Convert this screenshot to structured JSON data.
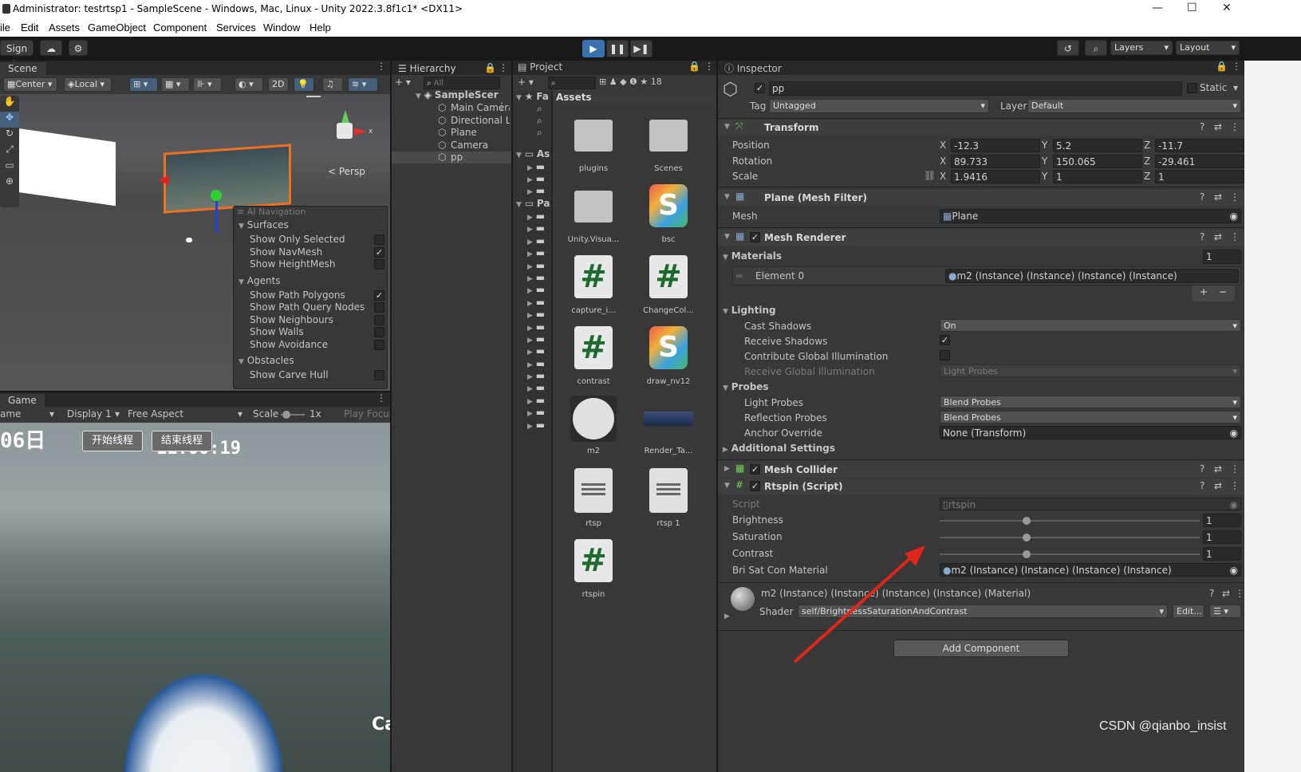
{
  "window": {
    "title": "Administrator: testrtsp1 - SampleScene - Windows, Mac, Linux - Unity 2022.3.8f1c1* <DX11>",
    "min": "—",
    "max": "☐",
    "close": "✕"
  },
  "menu": [
    "ile",
    "Edit",
    "Assets",
    "GameObject",
    "Component",
    "Services",
    "Window",
    "Help"
  ],
  "toolbar": {
    "signin": "Sign in",
    "layers": "Layers",
    "layout": "Layout"
  },
  "scene": {
    "tab": "Scene",
    "pivot": "Center",
    "space": "Local",
    "mode2d": "2D",
    "persp": "< Persp",
    "overlay": {
      "title": "AI Navigation",
      "sections": [
        {
          "name": "Surfaces",
          "items": [
            {
              "label": "Show Only Selected",
              "checked": false
            },
            {
              "label": "Show NavMesh",
              "checked": true
            },
            {
              "label": "Show HeightMesh",
              "checked": false
            }
          ]
        },
        {
          "name": "Agents",
          "items": [
            {
              "label": "Show Path Polygons",
              "checked": true
            },
            {
              "label": "Show Path Query Nodes",
              "checked": false
            },
            {
              "label": "Show Neighbours",
              "checked": false
            },
            {
              "label": "Show Walls",
              "checked": false
            },
            {
              "label": "Show Avoidance",
              "checked": false
            }
          ]
        },
        {
          "name": "Obstacles",
          "items": [
            {
              "label": "Show Carve Hull",
              "checked": false
            }
          ]
        }
      ]
    }
  },
  "game": {
    "tab": "Game",
    "view": "ame",
    "display": "Display 1",
    "aspect": "Free Aspect",
    "scale_label": "Scale",
    "scale_value": "1x",
    "play": "Play Focus",
    "date": "06日",
    "time": "11:00:19",
    "btn_start": "开始线程",
    "btn_end": "结束线程",
    "corner": "Ca"
  },
  "hierarchy": {
    "tab": "Hierarchy",
    "search": "All",
    "scene": "SampleScer",
    "items": [
      "Main Camera",
      "Directional Lig",
      "Plane",
      "Camera",
      "pp"
    ]
  },
  "project": {
    "tab": "Project",
    "fav": "Fa",
    "assets_tree": "As",
    "packages_tree": "Pa",
    "breadcrumb": "Assets",
    "count": "18",
    "assets": [
      {
        "name": "plugins",
        "kind": "folder"
      },
      {
        "name": "Scenes",
        "kind": "folder"
      },
      {
        "name": "Unity.Visua...",
        "kind": "folder"
      },
      {
        "name": "bsc",
        "kind": "shader"
      },
      {
        "name": "capture_i...",
        "kind": "script"
      },
      {
        "name": "ChangeCol...",
        "kind": "script"
      },
      {
        "name": "contrast",
        "kind": "script"
      },
      {
        "name": "draw_nv12",
        "kind": "shader"
      },
      {
        "name": "m2",
        "kind": "material"
      },
      {
        "name": "Render_Ta...",
        "kind": "texture"
      },
      {
        "name": "rtsp",
        "kind": "text"
      },
      {
        "name": "rtsp 1",
        "kind": "text"
      },
      {
        "name": "rtspin",
        "kind": "script"
      }
    ]
  },
  "inspector": {
    "tab": "Inspector",
    "name": "pp",
    "static": "Static",
    "tag_label": "Tag",
    "tag": "Untagged",
    "layer_label": "Layer",
    "layer": "Default",
    "transform": {
      "title": "Transform",
      "position_label": "Position",
      "rotation_label": "Rotation",
      "scale_label": "Scale",
      "position": {
        "x": "-12.3",
        "y": "5.2",
        "z": "-11.7"
      },
      "rotation": {
        "x": "89.733",
        "y": "150.065",
        "z": "-29.461"
      },
      "scale": {
        "x": "1.9416",
        "y": "1",
        "z": "1"
      }
    },
    "meshfilter": {
      "title": "Plane (Mesh Filter)",
      "mesh_label": "Mesh",
      "mesh": "Plane"
    },
    "meshrenderer": {
      "title": "Mesh Renderer",
      "materials_label": "Materials",
      "materials_count": "1",
      "element_label": "Element 0",
      "element": "m2 (Instance) (Instance) (Instance) (Instance)",
      "lighting_label": "Lighting",
      "cast_shadows_label": "Cast Shadows",
      "cast_shadows": "On",
      "receive_shadows_label": "Receive Shadows",
      "contribute_gi_label": "Contribute Global Illumination",
      "receive_gi_label": "Receive Global Illumination",
      "receive_gi": "Light Probes",
      "probes_label": "Probes",
      "light_probes_label": "Light Probes",
      "light_probes": "Blend Probes",
      "reflection_probes_label": "Reflection Probes",
      "reflection_probes": "Blend Probes",
      "anchor_label": "Anchor Override",
      "anchor": "None (Transform)",
      "additional_label": "Additional Settings"
    },
    "meshcollider": {
      "title": "Mesh Collider"
    },
    "rtspin": {
      "title": "Rtspin (Script)",
      "script_label": "Script",
      "script": "rtspin",
      "brightness_label": "Brightness",
      "brightness": "1",
      "saturation_label": "Saturation",
      "saturation": "1",
      "contrast_label": "Contrast",
      "contrast": "1",
      "bsc_label": "Bri Sat Con Material",
      "bsc": "m2 (Instance) (Instance) (Instance) (Instance)"
    },
    "material": {
      "title": "m2 (Instance) (Instance) (Instance) (Instance) (Material)",
      "shader_label": "Shader",
      "shader": "self/BrightnessSaturationAndContrast",
      "edit": "Edit..."
    },
    "add_component": "Add Component"
  },
  "watermark": "CSDN @qianbo_insist",
  "colors": {
    "accent": "#3a72b0",
    "arrow": "#e0261b",
    "orange": "#f07020"
  }
}
